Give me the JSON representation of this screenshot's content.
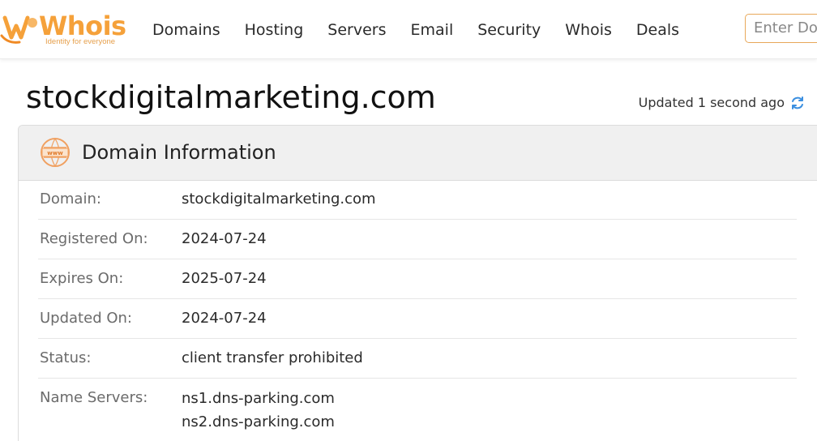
{
  "header": {
    "logo_text": "Whois",
    "logo_tagline": "Identity for everyone",
    "nav": [
      "Domains",
      "Hosting",
      "Servers",
      "Email",
      "Security",
      "Whois",
      "Deals"
    ],
    "search_placeholder": "Enter Domain"
  },
  "title": {
    "domain": "stockdigitalmarketing.com",
    "updated": "Updated 1 second ago"
  },
  "panel": {
    "title": "Domain Information",
    "rows": [
      {
        "label": "Domain:",
        "value": "stockdigitalmarketing.com"
      },
      {
        "label": "Registered On:",
        "value": "2024-07-24"
      },
      {
        "label": "Expires On:",
        "value": "2025-07-24"
      },
      {
        "label": "Updated On:",
        "value": "2024-07-24"
      },
      {
        "label": "Status:",
        "value": "client transfer prohibited"
      }
    ],
    "name_servers": {
      "label": "Name Servers:",
      "values": [
        "ns1.dns-parking.com",
        "ns2.dns-parking.com"
      ]
    }
  },
  "colors": {
    "brand_orange": "#f5a13a",
    "refresh_blue": "#3b8fe0"
  }
}
